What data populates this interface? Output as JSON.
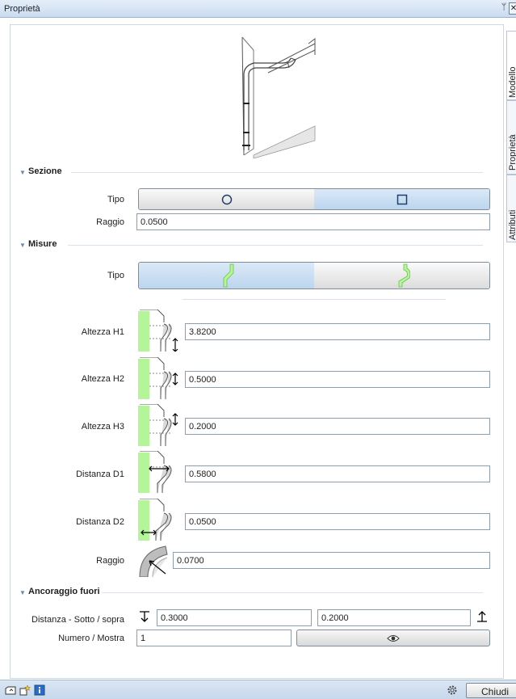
{
  "window": {
    "title": "Proprietà",
    "pin": "ᛘ",
    "close": "✕"
  },
  "side_tabs": [
    "Modello",
    "Proprietà",
    "Attributi"
  ],
  "sections": {
    "sezione": {
      "label": "Sezione",
      "tipo_label": "Tipo",
      "tipo_options": [
        "circle-icon",
        "square-icon"
      ],
      "tipo_selected": "square-icon",
      "raggio_label": "Raggio",
      "raggio_value": "0.0500"
    },
    "misure": {
      "label": "Misure",
      "tipo_label": "Tipo",
      "tipo_options": [
        "pipe-shape-a-icon",
        "pipe-shape-b-icon"
      ],
      "tipo_selected": "pipe-shape-a-icon",
      "rows": [
        {
          "label": "Altezza H1",
          "value": "3.8200"
        },
        {
          "label": "Altezza H2",
          "value": "0.5000"
        },
        {
          "label": "Altezza H3",
          "value": "0.2000"
        },
        {
          "label": "Distanza D1",
          "value": "0.5800"
        },
        {
          "label": "Distanza D2",
          "value": "0.0500"
        },
        {
          "label": "Raggio",
          "value": "0.0700"
        }
      ]
    },
    "ancoraggio": {
      "label": "Ancoraggio fuori",
      "distanza_label": "Distanza - Sotto / sopra",
      "sotto_value": "0.3000",
      "sopra_value": "0.2000",
      "numero_label": "Numero / Mostra",
      "numero_value": "1"
    }
  },
  "footer": {
    "close_label": "Chiudi"
  },
  "colors": {
    "accent_green": "#b5f59a",
    "selected_blue": "#c4daf1",
    "titlebar": "#d6e4f4"
  }
}
